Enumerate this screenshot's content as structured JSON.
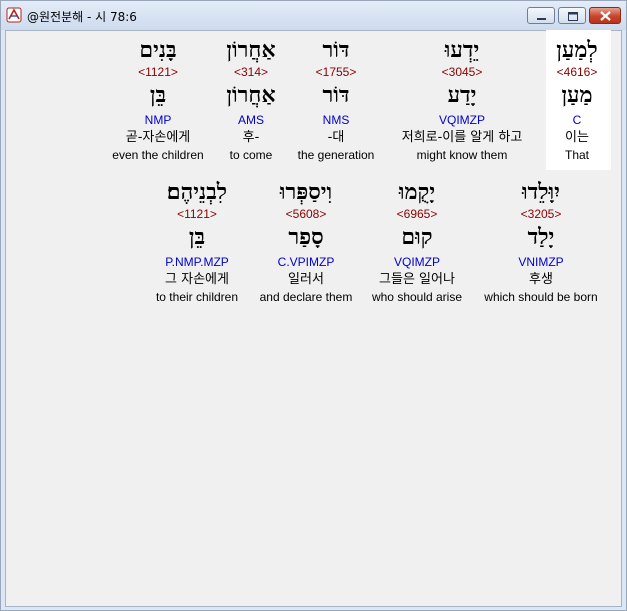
{
  "window": {
    "title": "@원전분해 - 시 78:6",
    "icons": {
      "app": "app-logo-icon",
      "minimize": "minimize-icon",
      "maximize": "maximize-icon",
      "close": "close-icon"
    },
    "colors": {
      "hebrew": "#000000",
      "strongs": "#8b0000",
      "morph": "#0000cc",
      "gloss": "#000000",
      "highlight": "#ffffff"
    }
  },
  "row1": [
    {
      "hebrew": "לְמַעַן",
      "strongs": "<4616>",
      "lemma": "מַעַן",
      "morph": "C",
      "korean": "이는",
      "english": "That"
    },
    {
      "hebrew": "יֵדְעוּ",
      "strongs": "<3045>",
      "lemma": "יָדַע",
      "morph": "VQIMZP",
      "korean": "저희로-이를 알게 하고",
      "english": "might know them"
    },
    {
      "hebrew": "דּוֹר",
      "strongs": "<1755>",
      "lemma": "דּוֹר",
      "morph": "NMS",
      "korean": "-대",
      "english": "the generation"
    },
    {
      "hebrew": "אַחֲרוֹן",
      "strongs": "<314>",
      "lemma": "אַחֲרוֹן",
      "morph": "AMS",
      "korean": "후-",
      "english": "to come"
    },
    {
      "hebrew": "בָּנִים",
      "strongs": "<1121>",
      "lemma": "בֵּן",
      "morph": "NMP",
      "korean": "곧-자손에게",
      "english": "even the children"
    }
  ],
  "row2": [
    {
      "hebrew": "יִוָּלֵדוּ",
      "strongs": "<3205>",
      "lemma": "יָלַד",
      "morph": "VNIMZP",
      "korean": "후생",
      "english": "which should be born"
    },
    {
      "hebrew": "יָקֻמוּ",
      "strongs": "<6965>",
      "lemma": "קוּם",
      "morph": "VQIMZP",
      "korean": "그들은 일어나",
      "english": "who should arise"
    },
    {
      "hebrew": "וִיסַפְּרוּ",
      "strongs": "<5608>",
      "lemma": "סָפַר",
      "morph": "C.VPIMZP",
      "korean": "일러서",
      "english": "and declare them"
    },
    {
      "hebrew": "לִבְנֵיהֶם׃",
      "strongs": "<1121>",
      "lemma": "בֵּן",
      "morph": "P.NMP.MZP",
      "korean": "그 자손에게",
      "english": "to their children"
    }
  ]
}
